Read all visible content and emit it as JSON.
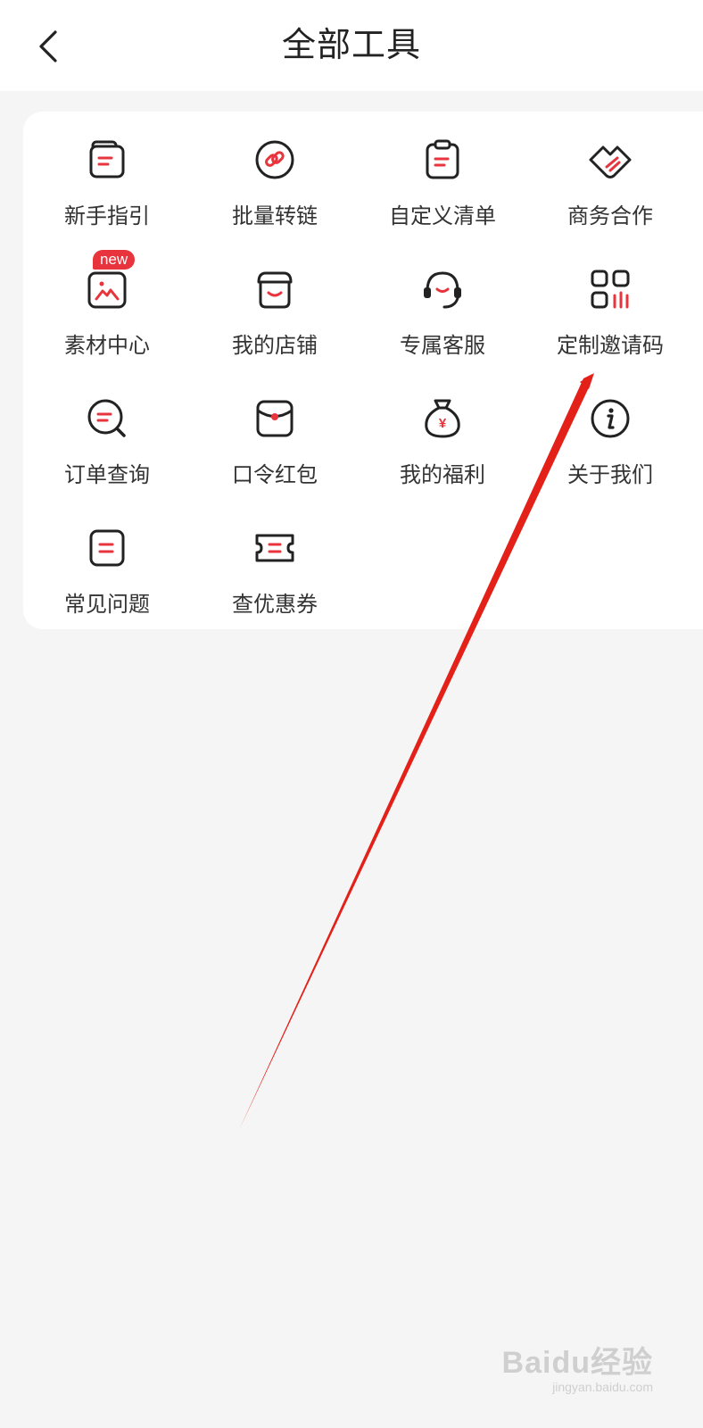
{
  "header": {
    "title": "全部工具"
  },
  "tools": [
    {
      "label": "新手指引",
      "icon": "guide-doc-icon"
    },
    {
      "label": "批量转链",
      "icon": "link-icon"
    },
    {
      "label": "自定义清单",
      "icon": "clipboard-list-icon"
    },
    {
      "label": "商务合作",
      "icon": "handshake-icon"
    },
    {
      "label": "素材中心",
      "icon": "image-folder-icon",
      "badge": "new"
    },
    {
      "label": "我的店铺",
      "icon": "store-icon"
    },
    {
      "label": "专属客服",
      "icon": "headset-icon"
    },
    {
      "label": "定制邀请码",
      "icon": "qr-code-icon"
    },
    {
      "label": "订单查询",
      "icon": "search-chat-icon"
    },
    {
      "label": "口令红包",
      "icon": "red-envelope-icon"
    },
    {
      "label": "我的福利",
      "icon": "money-bag-icon"
    },
    {
      "label": "关于我们",
      "icon": "info-icon"
    },
    {
      "label": "常见问题",
      "icon": "faq-doc-icon"
    },
    {
      "label": "查优惠券",
      "icon": "coupon-icon"
    }
  ],
  "watermark": {
    "logo": "Baidu经验",
    "url": "jingyan.baidu.com"
  },
  "colors": {
    "accent": "#e8343c",
    "icon_stroke": "#222222",
    "background": "#f5f5f5",
    "arrow": "#e32119"
  }
}
